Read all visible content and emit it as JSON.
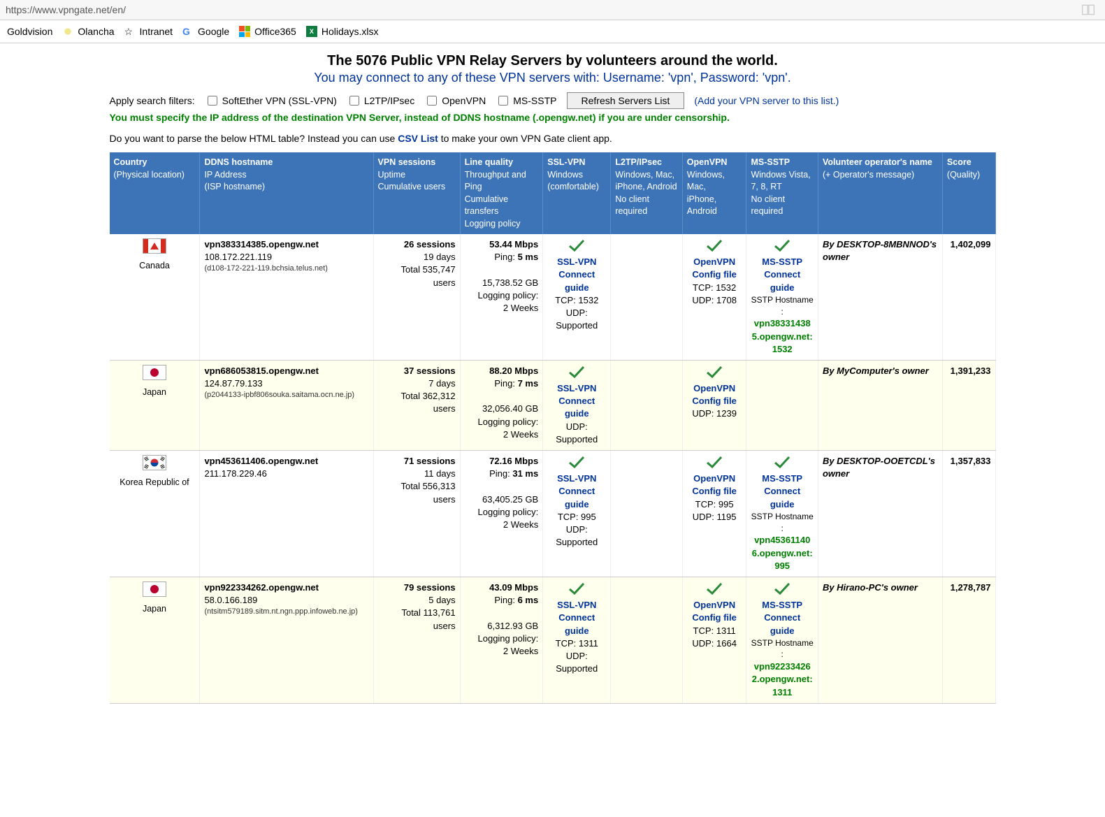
{
  "url": "https://www.vpngate.net/en/",
  "bookmarks": [
    "Goldvision",
    "Olancha",
    "Intranet",
    "Google",
    "Office365",
    "Holidays.xlsx"
  ],
  "title": "The 5076 Public VPN Relay Servers by volunteers around the world.",
  "subtitle": "You may connect to any of these VPN servers with: Username: 'vpn', Password: 'vpn'.",
  "filters_label": "Apply search filters:",
  "filters": {
    "softether": "SoftEther VPN (SSL-VPN)",
    "l2tp": "L2TP/IPsec",
    "openvpn": "OpenVPN",
    "mssstp": "MS-SSTP"
  },
  "refresh_btn": "Refresh Servers List",
  "add_link": "(Add your VPN server to this list.)",
  "warn": "You must specify the IP address of the destination VPN Server, instead of DDNS hostname (.opengw.net) if you are under censorship.",
  "parse": {
    "pre": "Do you want to parse the below HTML table? Instead you can use ",
    "link": "CSV List",
    "post": " to make your own VPN Gate client app."
  },
  "headers": {
    "country": {
      "t": "Country",
      "s": "(Physical location)"
    },
    "ddns": {
      "t": "DDNS hostname",
      "s1": "IP Address",
      "s2": "(ISP hostname)"
    },
    "sess": {
      "t": "VPN sessions",
      "s1": "Uptime",
      "s2": "Cumulative users"
    },
    "line": {
      "t": "Line quality",
      "s1": "Throughput and Ping",
      "s2": "Cumulative transfers",
      "s3": "Logging policy"
    },
    "ssl": {
      "t": "SSL-VPN",
      "s1": "Windows",
      "s2": "(comfortable)"
    },
    "l2tp": {
      "t": "L2TP/IPsec",
      "s1": "Windows, Mac,",
      "s2": "iPhone, Android",
      "s3": "No client required"
    },
    "ovpn": {
      "t": "OpenVPN",
      "s1": "Windows, Mac,",
      "s2": "iPhone, Android"
    },
    "sstp": {
      "t": "MS-SSTP",
      "s1": "Windows Vista,",
      "s2": "7, 8, RT",
      "s3": "No client required"
    },
    "op": {
      "t": "Volunteer operator's name",
      "s": "(+ Operator's message)"
    },
    "score": {
      "t": "Score",
      "s": "(Quality)"
    }
  },
  "labels": {
    "ssl_vpn": "SSL-VPN",
    "connect_guide": "Connect guide",
    "openvpn": "OpenVPN",
    "config_file": "Config file",
    "mssstp": "MS-SSTP",
    "sstp_hostname": "SSTP Hostname :",
    "logging_policy": "Logging policy:",
    "weeks2": "2 Weeks",
    "udp_supported": "UDP: Supported"
  },
  "rows": [
    {
      "country": "Canada",
      "flag": "ca",
      "ddns": "vpn383314385.opengw.net",
      "ip": "108.172.221.119",
      "isp": "(d108-172-221-119.bchsia.telus.net)",
      "sessions": "26 sessions",
      "uptime": "19 days",
      "cum_users": "Total 535,747 users",
      "throughput": "53.44 Mbps",
      "ping": "Ping: 5 ms",
      "transfers": "15,738.52 GB",
      "ssl": {
        "present": true,
        "tcp": "TCP: 1532",
        "udp": "UDP: Supported"
      },
      "l2tp": {
        "present": false
      },
      "ovpn": {
        "present": true,
        "tcp": "TCP: 1532",
        "udp": "UDP: 1708"
      },
      "sstp": {
        "present": true,
        "host": "vpn383314385.opengw.net:1532"
      },
      "op": "By DESKTOP-8MBNNOD's owner",
      "score": "1,402,099",
      "alt": "plain"
    },
    {
      "country": "Japan",
      "flag": "jp",
      "ddns": "vpn686053815.opengw.net",
      "ip": "124.87.79.133",
      "isp": "(p2044133-ipbf806souka.saitama.ocn.ne.jp)",
      "sessions": "37 sessions",
      "uptime": "7 days",
      "cum_users": "Total 362,312 users",
      "throughput": "88.20 Mbps",
      "ping": "Ping: 7 ms",
      "transfers": "32,056.40 GB",
      "ssl": {
        "present": true,
        "tcp": "",
        "udp": "UDP: Supported"
      },
      "l2tp": {
        "present": false
      },
      "ovpn": {
        "present": true,
        "tcp": "",
        "udp": "UDP: 1239"
      },
      "sstp": {
        "present": false
      },
      "op": "By MyComputer's owner",
      "score": "1,391,233",
      "alt": "alt"
    },
    {
      "country": "Korea Republic of",
      "flag": "kr",
      "ddns": "vpn453611406.opengw.net",
      "ip": "211.178.229.46",
      "isp": "",
      "sessions": "71 sessions",
      "uptime": "11 days",
      "cum_users": "Total 556,313 users",
      "throughput": "72.16 Mbps",
      "ping": "Ping: 31 ms",
      "transfers": "63,405.25 GB",
      "ssl": {
        "present": true,
        "tcp": "TCP: 995",
        "udp": "UDP: Supported"
      },
      "l2tp": {
        "present": false
      },
      "ovpn": {
        "present": true,
        "tcp": "TCP: 995",
        "udp": "UDP: 1195"
      },
      "sstp": {
        "present": true,
        "host": "vpn453611406.opengw.net:995"
      },
      "op": "By DESKTOP-OOETCDL's owner",
      "score": "1,357,833",
      "alt": "plain"
    },
    {
      "country": "Japan",
      "flag": "jp",
      "ddns": "vpn922334262.opengw.net",
      "ip": "58.0.166.189",
      "isp": "(ntsitm579189.sitm.nt.ngn.ppp.infoweb.ne.jp)",
      "sessions": "79 sessions",
      "uptime": "5 days",
      "cum_users": "Total 113,761 users",
      "throughput": "43.09 Mbps",
      "ping": "Ping: 6 ms",
      "transfers": "6,312.93 GB",
      "ssl": {
        "present": true,
        "tcp": "TCP: 1311",
        "udp": "UDP: Supported"
      },
      "l2tp": {
        "present": false
      },
      "ovpn": {
        "present": true,
        "tcp": "TCP: 1311",
        "udp": "UDP: 1664"
      },
      "sstp": {
        "present": true,
        "host": "vpn922334262.opengw.net:1311"
      },
      "op": "By Hirano-PC's owner",
      "score": "1,278,787",
      "alt": "alt"
    }
  ]
}
